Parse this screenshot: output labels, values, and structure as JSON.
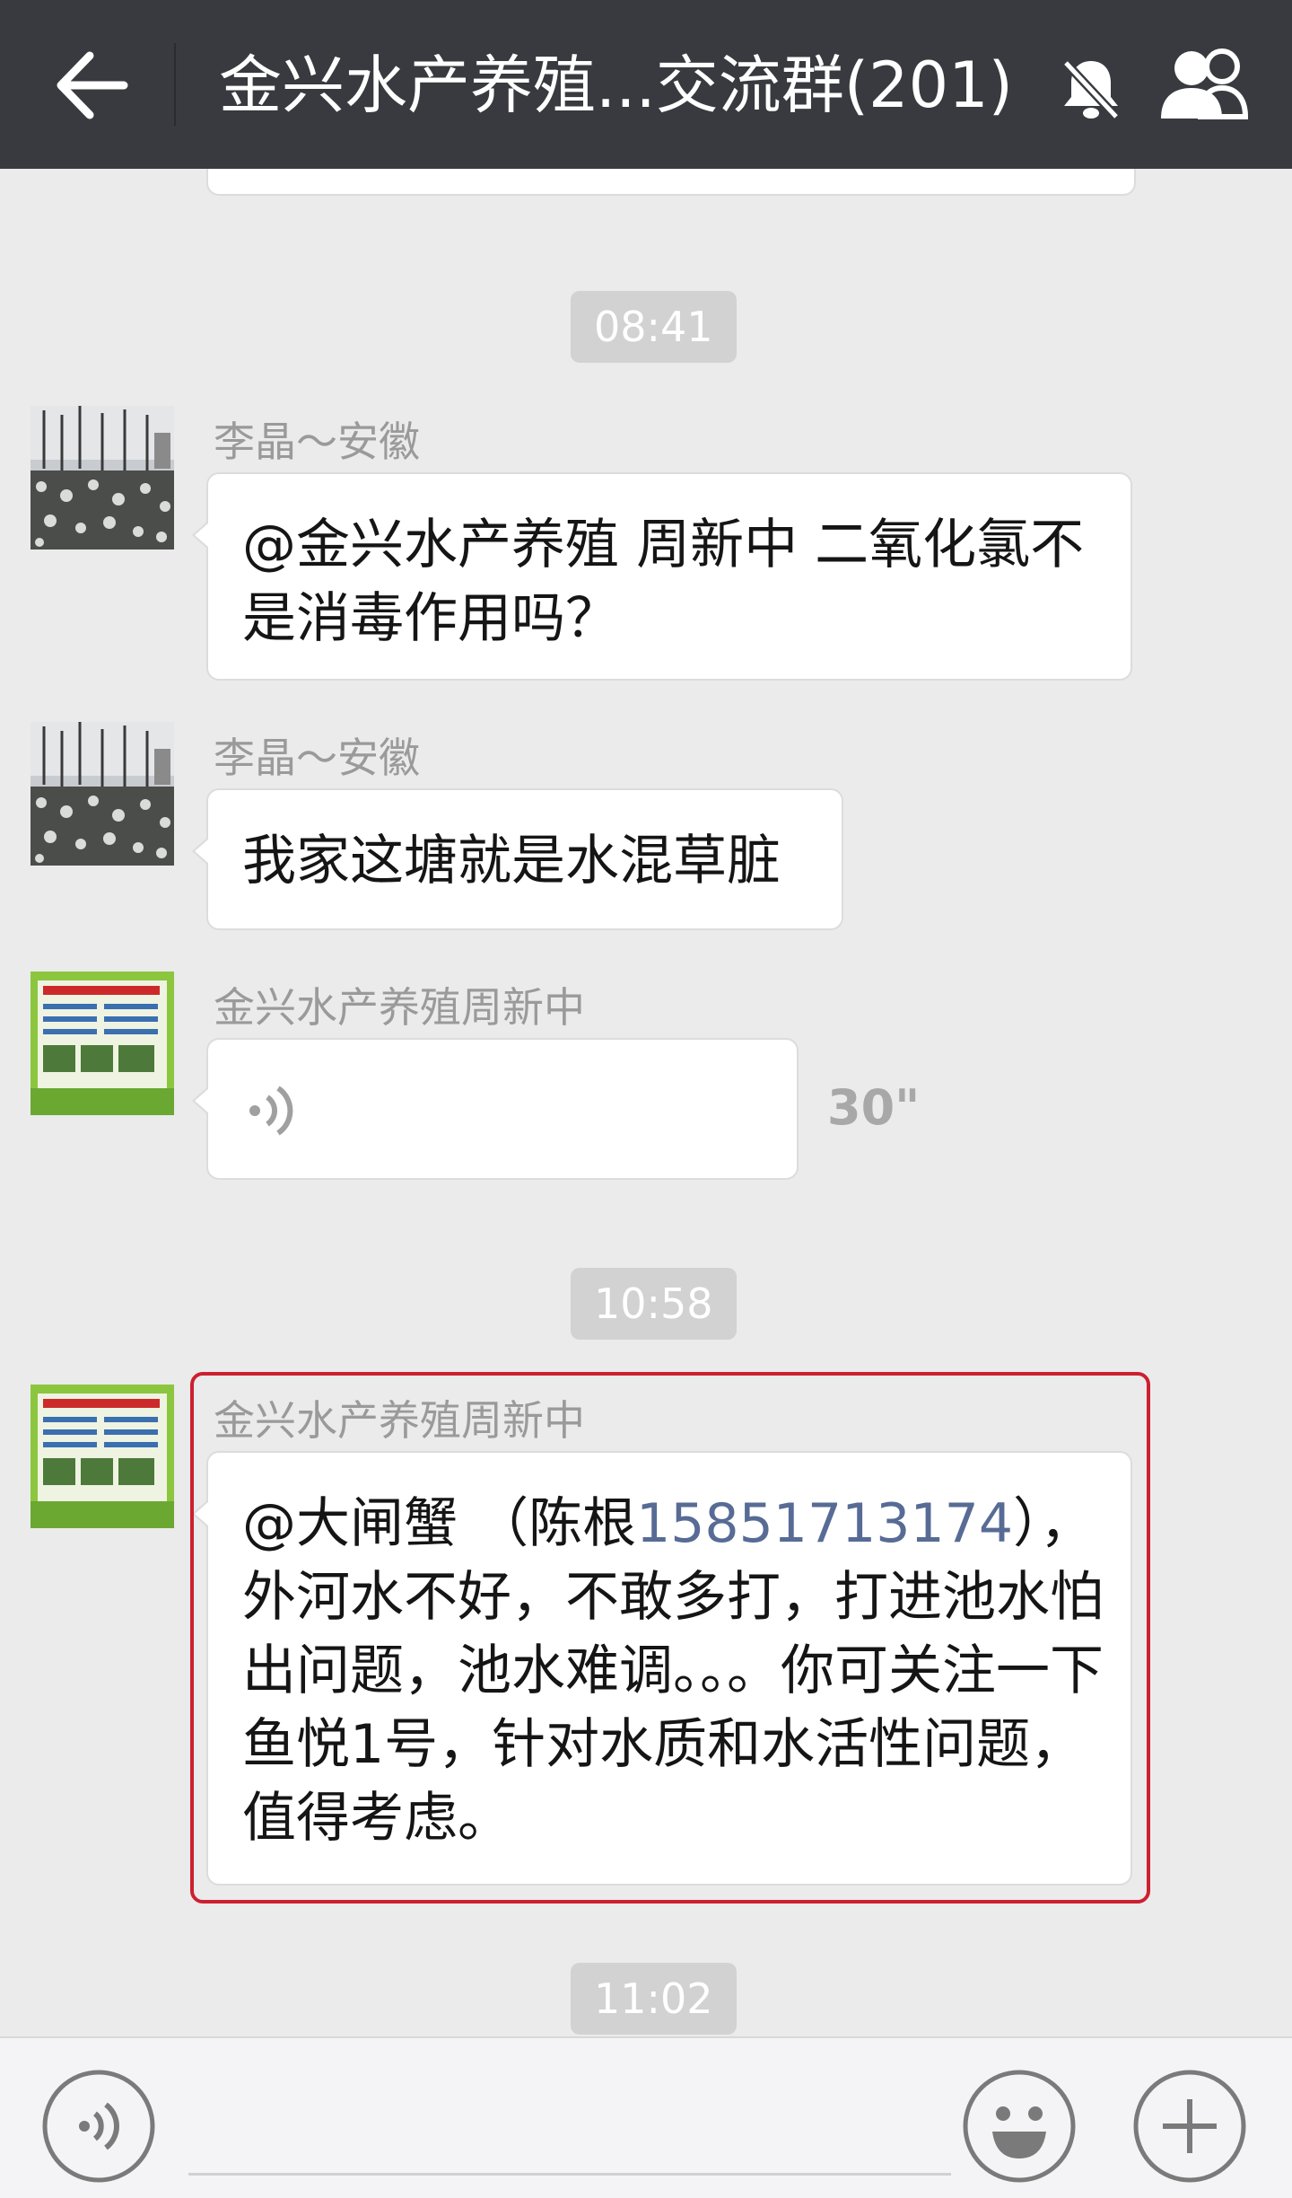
{
  "header": {
    "title": "金兴水产养殖...交流群(201)",
    "icons": [
      "back-arrow-icon",
      "mute-bell-icon",
      "group-members-icon"
    ]
  },
  "timestamps": [
    "08:41",
    "10:58",
    "11:02"
  ],
  "messages": [
    {
      "sender": "李晶～安徽",
      "text": "@金兴水产养殖  周新中 二氧化氯不是消毒作用吗？"
    },
    {
      "sender": "李晶～安徽",
      "text": "我家这塘就是水混草脏"
    },
    {
      "sender": "金兴水产养殖周新中",
      "type": "voice",
      "duration": "30\""
    },
    {
      "sender": "金兴水产养殖周新中",
      "text_before": "@大闸蟹 （陈根",
      "phone": "15851713174",
      "text_after": "），外河水不好，不敢多打，打进池水怕出问题，池水难调。。。你可关注一下鱼悦1号，针对水质和水活性问题，值得考虑。",
      "highlighted": true
    }
  ],
  "input_bar": {
    "icons": [
      "voice-input-icon",
      "emoji-icon",
      "plus-icon"
    ]
  },
  "colors": {
    "header_bg": "#393a3f",
    "chat_bg": "#ebebeb",
    "link": "#576b95",
    "highlight_border": "#cc2030"
  }
}
